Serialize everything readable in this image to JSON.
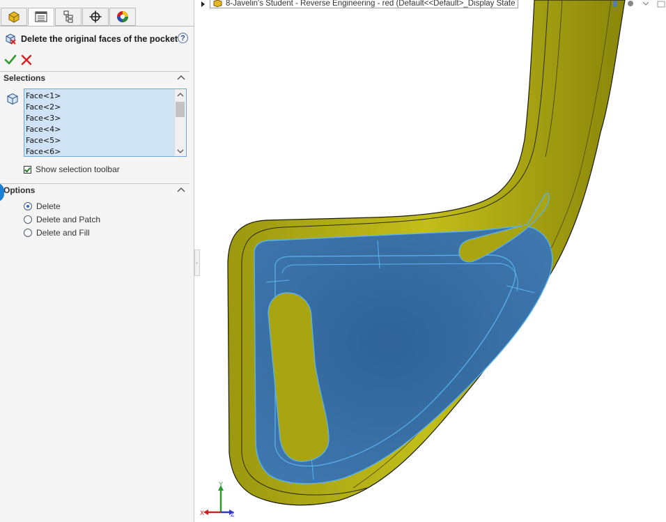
{
  "property_manager": {
    "tabs": [
      "feature-manager-tab",
      "property-manager-tab",
      "configuration-manager-tab",
      "dimxpert-manager-tab",
      "display-manager-tab"
    ],
    "active_tab": 1,
    "title": "Delete the original faces of the pocket",
    "help_icon_label": "?",
    "ok_label": "OK",
    "cancel_label": "Cancel",
    "selections": {
      "heading": "Selections",
      "items": [
        "Face<1>",
        "Face<2>",
        "Face<3>",
        "Face<4>",
        "Face<5>",
        "Face<6>"
      ],
      "show_toolbar_label": "Show selection toolbar",
      "show_toolbar_checked": true
    },
    "options": {
      "heading": "Options",
      "choices": [
        "Delete",
        "Delete and Patch",
        "Delete and Fill"
      ],
      "selected": "Delete"
    }
  },
  "graphics": {
    "document_title": "8-Javelin's Student - Reverse Engineering - red  (Default<<Default>_Display State",
    "triad": {
      "x_label": "X",
      "y_label": "Y",
      "z_label": "Z"
    },
    "colors": {
      "part_body": "#b8b414",
      "part_body_shade": "#8e8a0a",
      "selected_face": "#3a6fa3",
      "selected_edge": "#5ab4f0",
      "panel_bg": "#f5f5f5",
      "accent": "#1c7fd6"
    }
  }
}
